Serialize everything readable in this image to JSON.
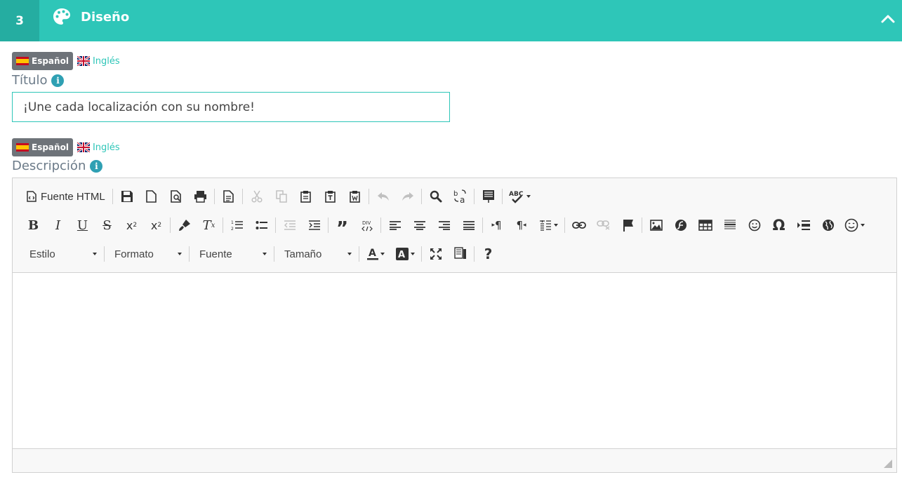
{
  "section": {
    "step_number": "3",
    "title": "Diseño"
  },
  "languages": {
    "active": "Español",
    "other": "Inglés"
  },
  "title_field": {
    "label": "Título",
    "value": "¡Une cada localización con su nombre!"
  },
  "description_field": {
    "label": "Descripción"
  },
  "editor": {
    "source_button": "Fuente HTML",
    "combos": {
      "style": "Estilo",
      "format": "Formato",
      "font": "Fuente",
      "size": "Tamaño"
    },
    "help_label": "?"
  },
  "colors": {
    "accent": "#2ec6b8",
    "accent_dark": "#25ada1",
    "info": "#2fa0b3"
  }
}
